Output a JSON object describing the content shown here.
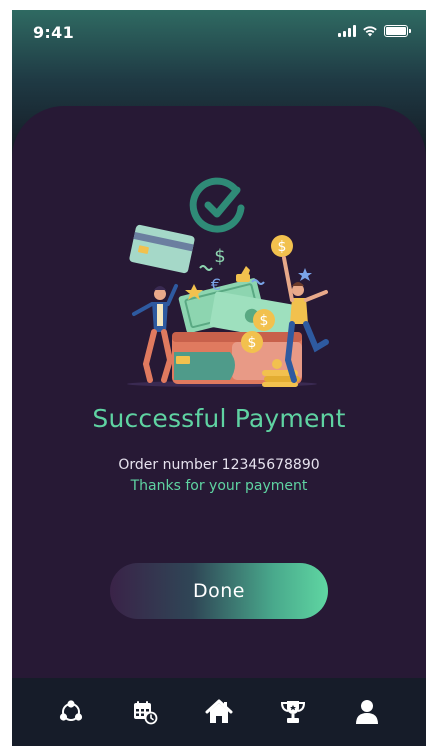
{
  "status_bar": {
    "time": "9:41",
    "icons": [
      "signal-icon",
      "wifi-icon",
      "battery-icon"
    ]
  },
  "illustration": {
    "check_icon": "check-circle-icon",
    "scene": "payment-celebration-illustration"
  },
  "content": {
    "title": "Successful Payment",
    "order_text": "Order number 12345678890",
    "thanks_text": "Thanks for your payment"
  },
  "actions": {
    "done_label": "Done"
  },
  "bottom_nav": {
    "items": [
      {
        "icon": "community-icon"
      },
      {
        "icon": "calendar-icon"
      },
      {
        "icon": "home-icon"
      },
      {
        "icon": "trophy-icon"
      },
      {
        "icon": "profile-icon"
      }
    ]
  },
  "colors": {
    "accent": "#5fd3a2",
    "card_background": "#271935",
    "nav_background": "#161c29"
  }
}
